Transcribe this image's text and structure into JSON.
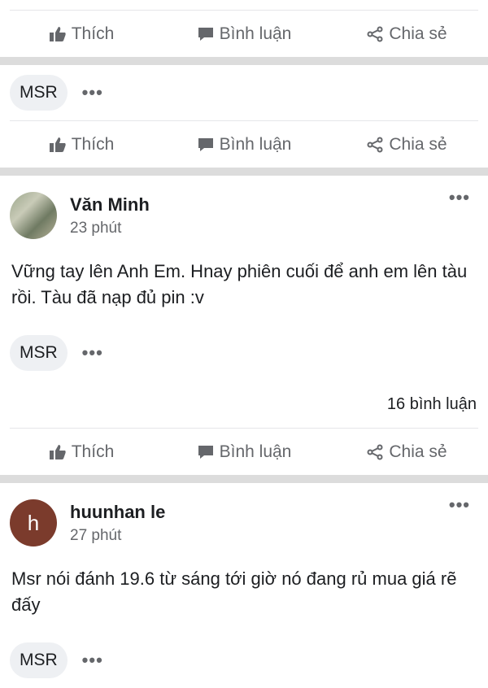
{
  "actions": {
    "like": "Thích",
    "comment": "Bình luận",
    "share": "Chia sẻ"
  },
  "tag": "MSR",
  "more": "•••",
  "post1": {
    "name": "Văn Minh",
    "time": "23 phút",
    "text": "Vững tay lên Anh Em. Hnay phiên cuối để anh em lên tàu rồi. Tàu đã nạp đủ pin :v",
    "comment_count": "16 bình luận"
  },
  "post2": {
    "avatar_letter": "h",
    "name": "huunhan le",
    "time": "27 phút",
    "text": "Msr nói đánh 19.6 từ sáng tới giờ nó đang rủ mua giá rẽ đấy"
  }
}
